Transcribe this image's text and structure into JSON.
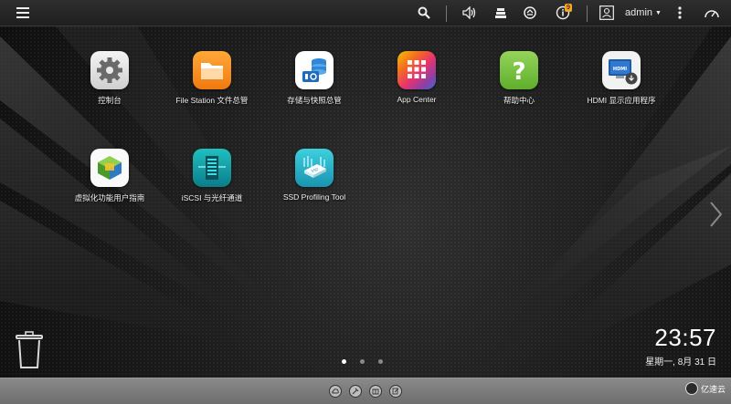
{
  "topbar": {
    "user": "admin",
    "notification_count": "9"
  },
  "apps": [
    {
      "label": "控制台",
      "icon": "control-panel-icon"
    },
    {
      "label": "File Station 文件总管",
      "icon": "file-station-icon"
    },
    {
      "label": "存储与快照总管",
      "icon": "storage-snapshots-icon"
    },
    {
      "label": "App Center",
      "icon": "app-center-icon"
    },
    {
      "label": "帮助中心",
      "icon": "help-center-icon"
    },
    {
      "label": "HDMI 显示应用程序",
      "icon": "hdmi-display-icon"
    },
    {
      "label": "虚拟化功能用户指南",
      "icon": "virtualization-guide-icon"
    },
    {
      "label": "iSCSI 与光纤通道",
      "icon": "iscsi-fibre-channel-icon"
    },
    {
      "label": "SSD Profiling Tool",
      "icon": "ssd-profiling-icon"
    }
  ],
  "clock": {
    "time": "23:57",
    "date": "星期一, 8月 31 日"
  },
  "pagination": {
    "current": 1,
    "total": 3
  },
  "watermark": {
    "text": "亿速云"
  },
  "colors": {
    "control_panel": "#9a9a9a",
    "file_station": "#f5921e",
    "storage": "#2e88d8",
    "help": "#7ac143",
    "hdmi": "#1e5aa8",
    "virtualization": "#6cbe45",
    "iscsi": "#16a6a6",
    "ssd": "#2cb5c9"
  }
}
